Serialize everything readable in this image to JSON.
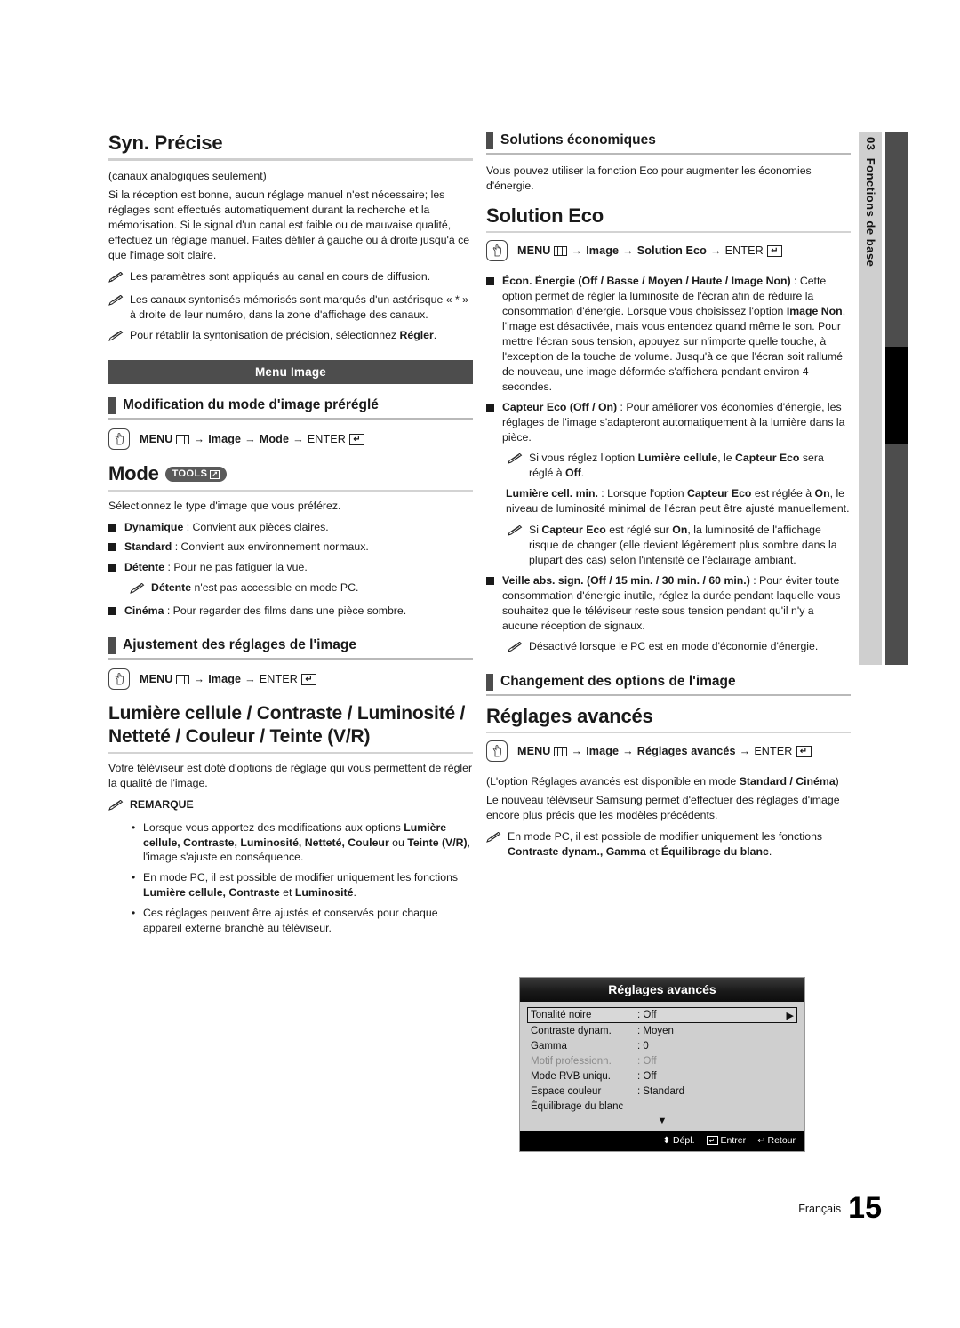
{
  "side_tab": {
    "number": "03",
    "label": "Fonctions de base"
  },
  "footer": {
    "language": "Français",
    "page_number": "15"
  },
  "left_column": {
    "syn_precise": {
      "title": "Syn. Précise",
      "subtitle": "(canaux analogiques seulement)",
      "body": "Si la réception est bonne, aucun réglage manuel n'est nécessaire; les réglages sont effectués automatiquement durant la recherche et la mémorisation. Si le signal d'un canal est faible ou de mauvaise qualité, effectuez un réglage manuel. Faites défiler à gauche ou à droite jusqu'à ce que l'image soit claire.",
      "note1": "Les paramètres sont appliqués au canal en cours de diffusion.",
      "note2": "Les canaux syntonisés mémorisés sont marqués d'un astérisque « * » à droite de leur numéro, dans la zone d'affichage des canaux.",
      "note3_pre": "Pour rétablir la syntonisation de précision, sélectionnez ",
      "note3_bold": "Régler",
      "note3_post": "."
    },
    "banner": "Menu Image",
    "section_mode": {
      "heading": "Modification du mode d'image préréglé",
      "path": {
        "menu": "MENU",
        "steps": [
          "Image",
          "Mode"
        ],
        "enter": "ENTER"
      },
      "title": "Mode",
      "tools_badge": "TOOLS",
      "intro": "Sélectionnez le type d'image que vous préférez.",
      "options": [
        {
          "name": "Dynamique",
          "desc": " : Convient aux pièces claires."
        },
        {
          "name": "Standard",
          "desc": " : Convient aux environnement normaux."
        },
        {
          "name": "Détente",
          "desc": " : Pour ne pas fatiguer la vue."
        },
        {
          "name": "Cinéma",
          "desc": " : Pour regarder des films dans une pièce sombre."
        }
      ],
      "detente_note_bold": "Détente",
      "detente_note_rest": " n'est pas accessible en mode PC."
    },
    "section_adjust": {
      "heading": "Ajustement des réglages de l'image",
      "path": {
        "menu": "MENU",
        "steps": [
          "Image"
        ],
        "enter": "ENTER"
      },
      "title": "Lumière cellule / Contraste / Luminosité / Netteté / Couleur / Teinte (V/R)",
      "body": "Votre téléviseur est doté d'options de réglage qui vous permettent de régler la qualité de l'image.",
      "remark_label": "REMARQUE",
      "remarks": [
        {
          "pre": "Lorsque vous apportez des modifications aux options ",
          "bold1": "Lumière cellule, Contraste, Luminosité, Netteté, Couleur",
          "mid": " ou ",
          "bold2": "Teinte (V/R)",
          "post": ", l'image s'ajuste en conséquence."
        },
        {
          "pre": "En mode PC, il est possible de modifier uniquement les fonctions ",
          "bold1": "Lumière cellule, Contraste",
          "mid": " et ",
          "bold2": "Luminosité",
          "post": "."
        },
        {
          "pre": "Ces réglages peuvent être ajustés et conservés pour chaque appareil externe branché au téléviseur.",
          "bold1": "",
          "mid": "",
          "bold2": "",
          "post": ""
        }
      ]
    }
  },
  "right_column": {
    "section_eco": {
      "heading": "Solutions économiques",
      "intro": "Vous pouvez utiliser la fonction Eco pour augmenter les économies d'énergie.",
      "title": "Solution Eco",
      "path": {
        "menu": "MENU",
        "steps": [
          "Image",
          "Solution Eco"
        ],
        "enter": "ENTER"
      },
      "item_econ": {
        "bold": "Écon. Énergie (Off / Basse / Moyen / Haute / Image Non)",
        "text1": " : Cette option permet de régler la luminosité de l'écran afin de réduire la consommation d'énergie. Lorsque vous choisissez l'option ",
        "bold2": "Image Non",
        "text2": ", l'image est désactivée, mais vous entendez quand même le son. Pour mettre l'écran sous tension, appuyez sur n'importe quelle touche, à l'exception de la touche de volume. Jusqu'à ce que l'écran soit rallumé de nouveau, une image déformée s'affichera pendant environ 4 secondes."
      },
      "item_capteur": {
        "bold": "Capteur Eco (Off / On)",
        "text": " : Pour améliorer vos économies d'énergie, les réglages de l'image s'adapteront automatiquement à la lumière dans la pièce."
      },
      "note_capteur": {
        "pre": "Si vous réglez l'option ",
        "b1": "Lumière cellule",
        "mid": ", le ",
        "b2": "Capteur Eco",
        "mid2": " sera réglé à ",
        "b3": "Off",
        "post": "."
      },
      "lumiere_min": {
        "bold": "Lumière cell. min.",
        "text1": " : Lorsque l'option ",
        "b2": "Capteur Eco",
        "text2": " est réglée à ",
        "b3": "On",
        "text3": ", le niveau de luminosité minimal de l'écran peut être ajusté manuellement."
      },
      "note_capteur2": {
        "pre": "Si ",
        "b1": "Capteur Eco",
        "mid": " est réglé sur ",
        "b2": "On",
        "post": ", la luminosité de l'affichage risque de changer (elle devient légèrement plus sombre dans la plupart des cas) selon l'intensité de l'éclairage ambiant."
      },
      "item_veille": {
        "bold": "Veille abs. sign. (Off / 15 min. / 30 min. / 60 min.)",
        "text": " : Pour éviter toute consommation d'énergie inutile, réglez la durée pendant laquelle vous souhaitez que le téléviseur reste sous tension pendant qu'il n'y a aucune réception de signaux."
      },
      "note_veille": "Désactivé lorsque le PC est en mode d'économie d'énergie."
    },
    "section_options": {
      "heading": "Changement des options de l'image",
      "title": "Réglages avancés",
      "path": {
        "menu": "MENU",
        "steps": [
          "Image",
          "Réglages avancés"
        ],
        "enter": "ENTER"
      },
      "avail_pre": "(L'option Réglages avancés est disponible en mode ",
      "avail_bold": "Standard / Cinéma",
      "avail_post": ")",
      "body": "Le nouveau téléviseur Samsung permet d'effectuer des réglages d'image encore plus précis que les modèles précédents.",
      "note": {
        "pre": "En mode PC, il est possible de modifier uniquement les fonctions ",
        "b1": "Contraste dynam., Gamma",
        "mid": " et ",
        "b2": "Équilibrage du blanc",
        "post": "."
      }
    },
    "osd": {
      "title": "Réglages avancés",
      "rows": [
        {
          "label": "Tonalité noire",
          "value": ": Off",
          "selected": true,
          "dim": false,
          "arrow": "▶"
        },
        {
          "label": "Contraste dynam.",
          "value": ": Moyen",
          "selected": false,
          "dim": false,
          "arrow": ""
        },
        {
          "label": "Gamma",
          "value": ": 0",
          "selected": false,
          "dim": false,
          "arrow": ""
        },
        {
          "label": "Motif professionn.",
          "value": ": Off",
          "selected": false,
          "dim": true,
          "arrow": ""
        },
        {
          "label": "Mode RVB uniqu.",
          "value": ": Off",
          "selected": false,
          "dim": false,
          "arrow": ""
        },
        {
          "label": "Espace couleur",
          "value": ": Standard",
          "selected": false,
          "dim": false,
          "arrow": ""
        },
        {
          "label": "Équilibrage du blanc",
          "value": "",
          "selected": false,
          "dim": false,
          "arrow": ""
        }
      ],
      "scroll_down": "▼",
      "footer": {
        "move": "Dépl.",
        "enter": "Entrer",
        "return": "Retour"
      }
    }
  }
}
